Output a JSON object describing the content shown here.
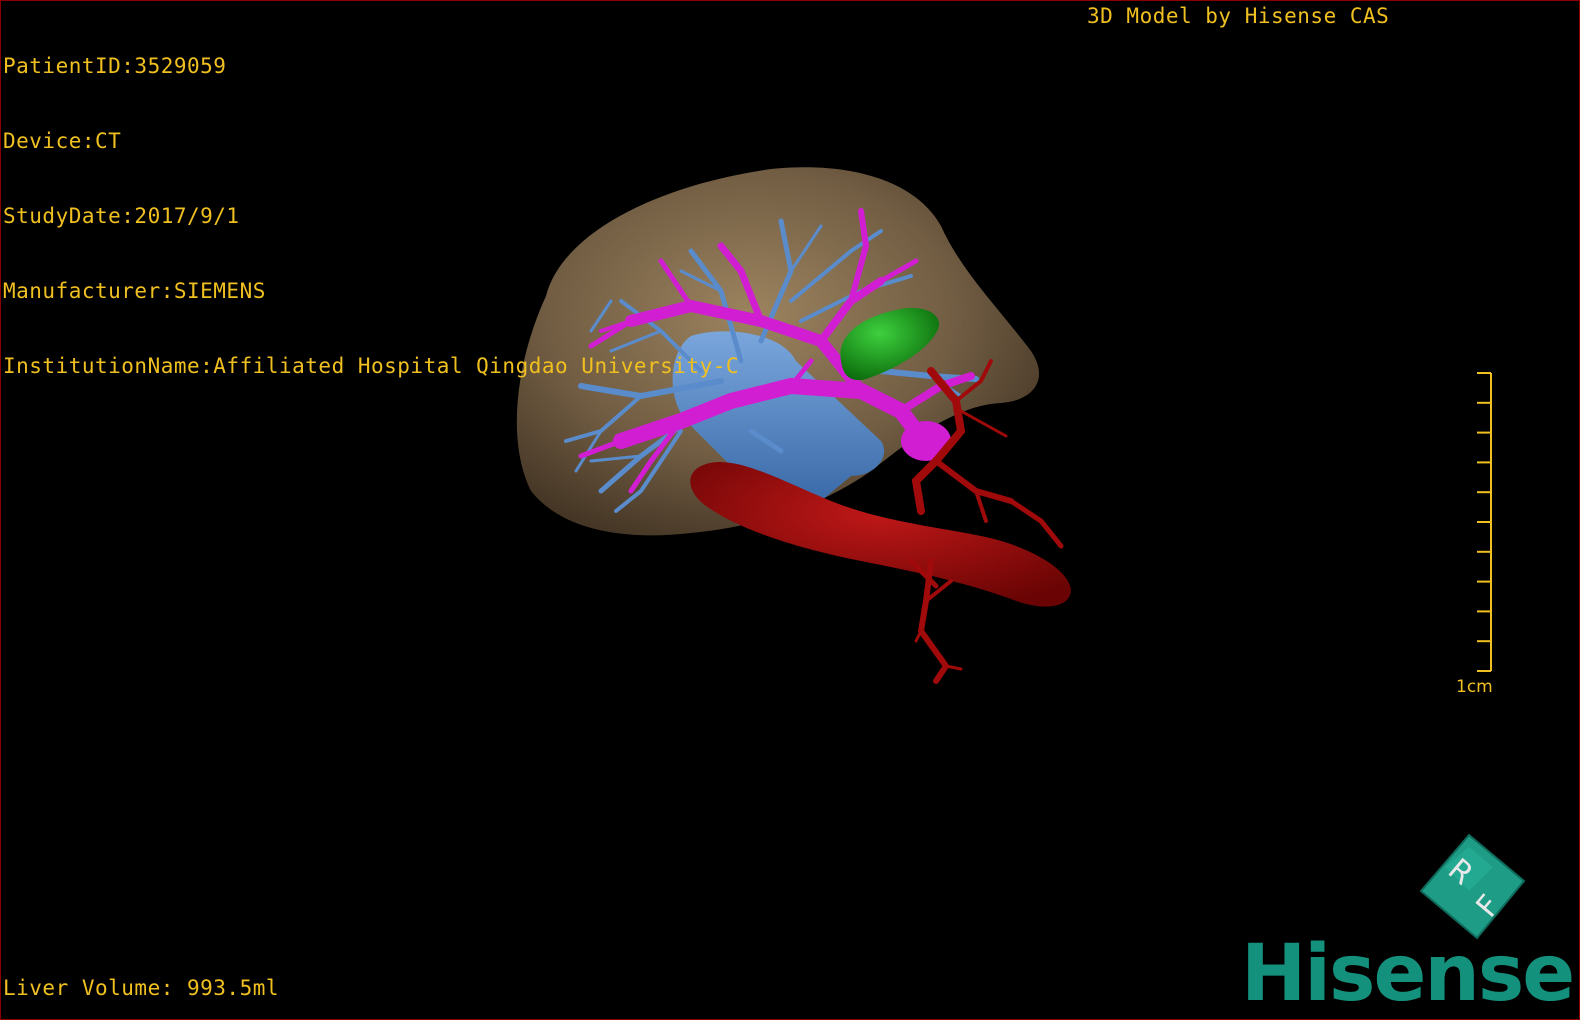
{
  "patient_info": {
    "patient_id": "PatientID:3529059",
    "device": "Device:CT",
    "study_date": "StudyDate:2017/9/1",
    "manufacturer": "Manufacturer:SIEMENS",
    "institution": "InstitutionName:Affiliated Hospital Qingdao University-C"
  },
  "header": {
    "model_credit": "3D Model by Hisense CAS"
  },
  "footer": {
    "liver_volume": "Liver Volume: 993.5ml"
  },
  "scale_bar": {
    "label": "1cm",
    "ticks": 10
  },
  "orientation_cube": {
    "face_labels": [
      "R",
      "F"
    ]
  },
  "logo": {
    "text": "Hisense"
  },
  "colors": {
    "overlay_text": "#f0c020",
    "liver": "#8c7656",
    "portal_vein": "#d21ed2",
    "hepatic_vein": "#5a8ccc",
    "artery": "#a00a0a",
    "gallbladder": "#14a014",
    "brand": "#14917d"
  },
  "structures": [
    "liver-surface",
    "portal-vein",
    "hepatic-veins",
    "inferior-vena-cava",
    "hepatic-artery",
    "aorta",
    "gallbladder"
  ]
}
